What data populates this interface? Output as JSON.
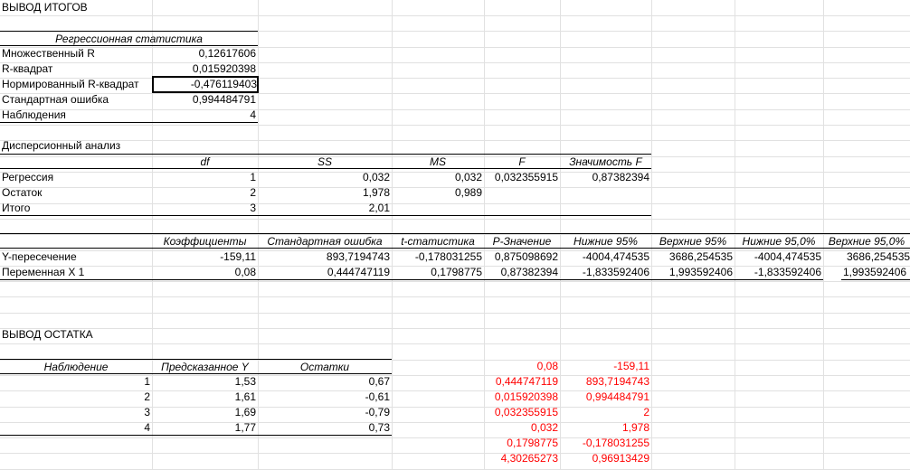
{
  "output_title": "ВЫВОД ИТОГОВ",
  "regstat": {
    "header": "Регрессионная статистика",
    "rows": [
      {
        "label": "Множественный R",
        "value": "0,12617606"
      },
      {
        "label": "R-квадрат",
        "value": "0,015920398"
      },
      {
        "label": "Нормированный R-квадрат",
        "value": "-0,476119403"
      },
      {
        "label": "Стандартная ошибка",
        "value": "0,994484791"
      },
      {
        "label": "Наблюдения",
        "value": "4"
      }
    ]
  },
  "anova": {
    "title": "Дисперсионный анализ",
    "headers": [
      "df",
      "SS",
      "MS",
      "F",
      "Значимость F"
    ],
    "rows": [
      {
        "label": "Регрессия",
        "df": "1",
        "ss": "0,032",
        "ms": "0,032",
        "f": "0,032355915",
        "sig": "0,87382394"
      },
      {
        "label": "Остаток",
        "df": "2",
        "ss": "1,978",
        "ms": "0,989",
        "f": "",
        "sig": ""
      },
      {
        "label": "Итого",
        "df": "3",
        "ss": "2,01",
        "ms": "",
        "f": "",
        "sig": ""
      }
    ]
  },
  "coef": {
    "headers": [
      "Коэффициенты",
      "Стандартная ошибка",
      "t-статистика",
      "P-Значение",
      "Нижние 95%",
      "Верхние 95%",
      "Нижние 95,0%",
      "Верхние 95,0%"
    ],
    "rows": [
      {
        "label": "Y-пересечение",
        "vals": [
          "-159,11",
          "893,7194743",
          "-0,178031255",
          "0,875098692",
          "-4004,474535",
          "3686,254535",
          "-4004,474535",
          "3686,254535"
        ]
      },
      {
        "label": "Переменная X 1",
        "vals": [
          "0,08",
          "0,444747119",
          "0,1798775",
          "0,87382394",
          "-1,833592406",
          "1,993592406",
          "-1,833592406",
          "1,993592406"
        ]
      }
    ]
  },
  "residual_title": "ВЫВОД ОСТАТКА",
  "residuals": {
    "headers": [
      "Наблюдение",
      "Предсказанное Y",
      "Остатки"
    ],
    "rows": [
      {
        "n": "1",
        "pred": "1,53",
        "res": "0,67"
      },
      {
        "n": "2",
        "pred": "1,61",
        "res": "-0,61"
      },
      {
        "n": "3",
        "pred": "1,69",
        "res": "-0,79"
      },
      {
        "n": "4",
        "pred": "1,77",
        "res": "0,73"
      }
    ]
  },
  "red_block": [
    [
      "0,08",
      "-159,11"
    ],
    [
      "0,444747119",
      "893,7194743"
    ],
    [
      "0,015920398",
      "0,994484791"
    ],
    [
      "0,032355915",
      "2"
    ],
    [
      "0,032",
      "1,978"
    ],
    [
      "0,1798775",
      "-0,178031255"
    ],
    [
      "4,30265273",
      "0,96913429"
    ]
  ],
  "colors": {
    "accent_red": "#ff0000",
    "gridline": "#e1e1e1",
    "border": "#000000"
  }
}
